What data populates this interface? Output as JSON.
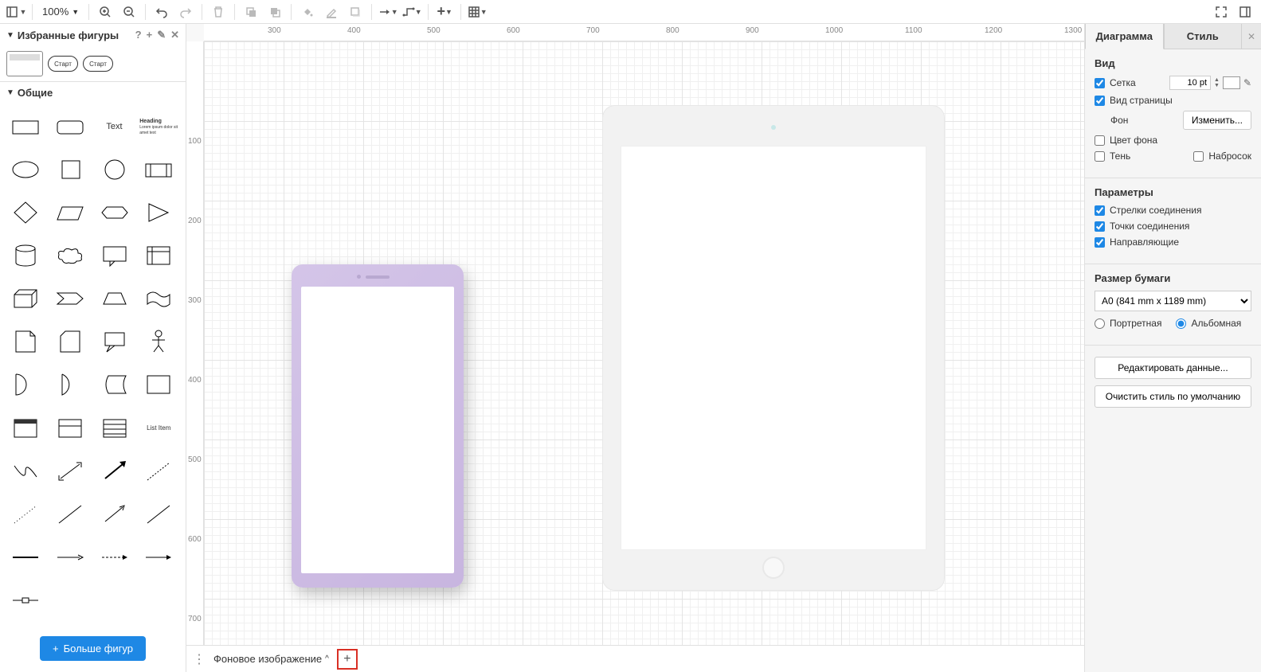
{
  "toolbar": {
    "zoom": "100%"
  },
  "sidebar": {
    "favorites_title": "Избранные фигуры",
    "pill1": "Старт",
    "pill2": "Старт",
    "general_title": "Общие",
    "text_label": "Text",
    "heading_label": "Heading",
    "list_item_label": "List Item",
    "more_shapes": "Больше фигур"
  },
  "ruler_h": [
    "300",
    "400",
    "500",
    "600",
    "700",
    "800",
    "900",
    "1000",
    "1100",
    "1200",
    "1300"
  ],
  "ruler_v": [
    "100",
    "200",
    "300",
    "400",
    "500",
    "600",
    "700"
  ],
  "bottom": {
    "page_name": "Фоновое изображение"
  },
  "right": {
    "tab_diagram": "Диаграмма",
    "tab_style": "Стиль",
    "view_title": "Вид",
    "grid_label": "Сетка",
    "grid_size": "10 pt",
    "page_view": "Вид страницы",
    "background": "Фон",
    "change_btn": "Изменить...",
    "bg_color": "Цвет фона",
    "shadow": "Тень",
    "sketch": "Набросок",
    "params_title": "Параметры",
    "conn_arrows": "Стрелки соединения",
    "conn_points": "Точки соединения",
    "guides": "Направляющие",
    "paper_title": "Размер бумаги",
    "paper_size": "A0 (841 mm x 1189 mm)",
    "portrait": "Портретная",
    "landscape": "Альбомная",
    "edit_data": "Редактировать данные...",
    "clear_style": "Очистить стиль по умолчанию"
  }
}
